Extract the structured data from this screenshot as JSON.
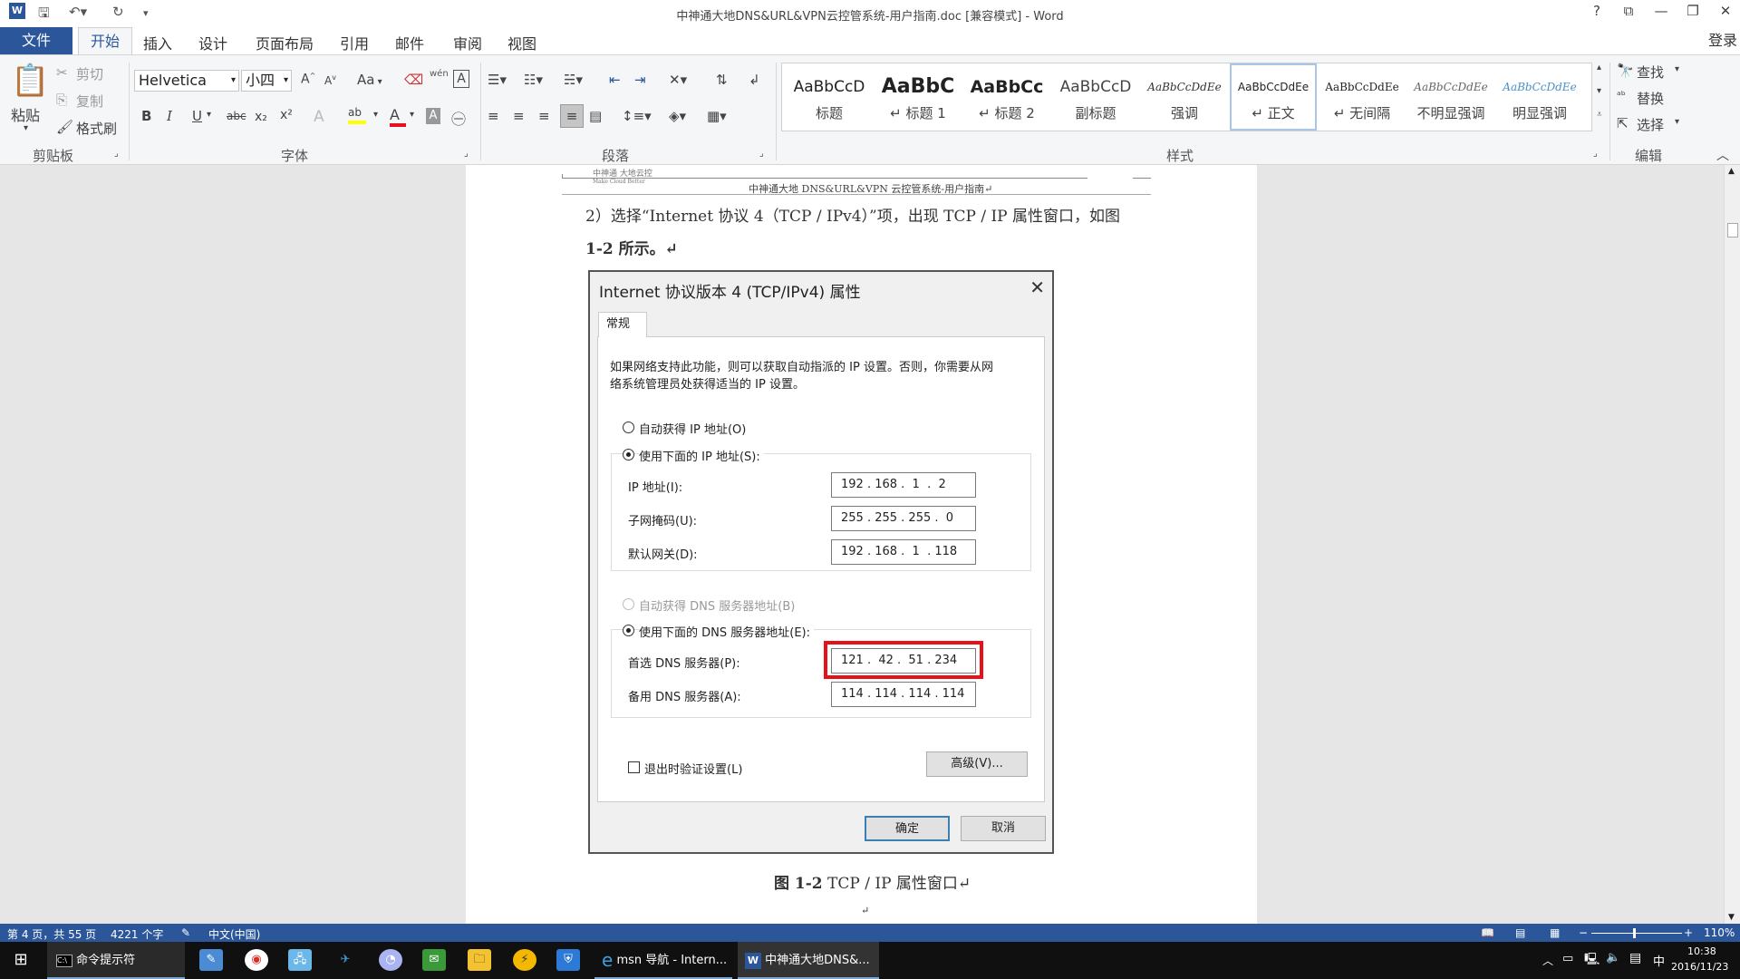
{
  "window": {
    "title": "中神通大地DNS&URL&VPN云控管系统-用户指南.doc [兼容模式] - Word",
    "help": "?",
    "login": "登录"
  },
  "tabs": {
    "file": "文件",
    "home": "开始",
    "insert": "插入",
    "design": "设计",
    "layout": "页面布局",
    "references": "引用",
    "mailings": "邮件",
    "review": "审阅",
    "view": "视图"
  },
  "clipboard": {
    "paste": "粘贴",
    "cut": "剪切",
    "copy": "复制",
    "format_painter": "格式刷",
    "label": "剪贴板"
  },
  "font": {
    "name": "Helvetica",
    "size": "小四",
    "label": "字体",
    "bold": "B",
    "italic": "I",
    "underline": "U",
    "strike": "abc",
    "sub": "x₂",
    "sup": "x²",
    "grow": "A",
    "shrink": "A",
    "case": "Aa",
    "wen": "wén",
    "color_a": "A"
  },
  "paragraph": {
    "label": "段落"
  },
  "styles": {
    "label": "样式",
    "items": [
      {
        "sample": "AaBbCcD",
        "name": "标题"
      },
      {
        "sample": "AaBbC",
        "name": "↵ 标题 1"
      },
      {
        "sample": "AaBbCc",
        "name": "↵ 标题 2"
      },
      {
        "sample": "AaBbCcD",
        "name": "副标题"
      },
      {
        "sample": "AaBbCcDdEe",
        "name": "强调"
      },
      {
        "sample": "AaBbCcDdEe",
        "name": "↵ 正文"
      },
      {
        "sample": "AaBbCcDdEe",
        "name": "↵ 无间隔"
      },
      {
        "sample": "AaBbCcDdEe",
        "name": "不明显强调"
      },
      {
        "sample": "AaBbCcDdEe",
        "name": "明显强调"
      }
    ]
  },
  "editing": {
    "label": "编辑",
    "find": "查找",
    "replace": "替换",
    "select": "选择"
  },
  "document": {
    "logo_line1": "中神通 大地云控",
    "logo_line2": "Make Cloud Better",
    "header": "中神通大地 DNS&URL&VPN 云控管系统-用户指南↵",
    "para_line1": "2）选择“Internet 协议 4（TCP / IPv4）”项，出现 TCP / IP 属性窗口，如图",
    "para_line2": "1-2 所示。↵",
    "caption_bold": "图 1-2",
    "caption_rest": " TCP / IP 属性窗口↵",
    "end_mark": "↵"
  },
  "dialog": {
    "title": "Internet 协议版本 4 (TCP/IPv4) 属性",
    "tab": "常规",
    "desc_line1": "如果网络支持此功能，则可以获取自动指派的 IP 设置。否则，你需要从网",
    "desc_line2": "络系统管理员处获得适当的 IP 设置。",
    "auto_ip": "自动获得 IP 地址(O)",
    "use_ip": "使用下面的 IP 地址(S):",
    "ip_label": "IP 地址(I):",
    "ip_value": "192 . 168 .  1  .  2",
    "mask_label": "子网掩码(U):",
    "mask_value": "255 . 255 . 255 .  0",
    "gw_label": "默认网关(D):",
    "gw_value": "192 . 168 .  1  . 118",
    "auto_dns": "自动获得 DNS 服务器地址(B)",
    "use_dns": "使用下面的 DNS 服务器地址(E):",
    "dns1_label": "首选 DNS 服务器(P):",
    "dns1_value": "121 .  42 .  51 . 234",
    "dns2_label": "备用 DNS 服务器(A):",
    "dns2_value": "114 . 114 . 114 . 114",
    "validate": "退出时验证设置(L)",
    "advanced": "高级(V)...",
    "ok": "确定",
    "cancel": "取消",
    "highlight_color": "#e8101a"
  },
  "status": {
    "page": "第 4 页，共 55 页",
    "words": "4221 个字",
    "lang": "中文(中国)",
    "zoom": "110%"
  },
  "taskbar": {
    "cmd": "命令提示符",
    "ie": "msn 导航 - Intern...",
    "word": "中神通大地DNS&...",
    "time": "10:38",
    "date": "2016/11/23",
    "ime": "中"
  },
  "colors": {
    "accent": "#2b579a",
    "taskbar": "#101010"
  }
}
